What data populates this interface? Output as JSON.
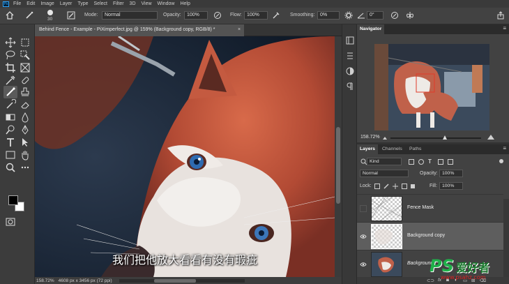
{
  "menubar": {
    "logo": "Ps",
    "items": [
      "File",
      "Edit",
      "Image",
      "Layer",
      "Type",
      "Select",
      "Filter",
      "3D",
      "View",
      "Window",
      "Help"
    ]
  },
  "options": {
    "brush_size": "30",
    "mode_label": "Mode:",
    "mode_value": "Normal",
    "opacity_label": "Opacity:",
    "opacity_value": "100%",
    "flow_label": "Flow:",
    "flow_value": "100%",
    "smoothing_label": "Smoothing:",
    "smoothing_value": "0%",
    "angle_value": "0°"
  },
  "document": {
    "tab_title": "Behind Fence - Example - PiXimperfect.jpg @ 159% (Background copy, RGB/8) *",
    "close_glyph": "×",
    "subtitle": "我们把他放大看看有没有瑕疵"
  },
  "status": {
    "zoom": "158.72%",
    "dimensions": "4608 px x 3456 px (72 ppi)"
  },
  "navigator": {
    "tab": "Navigator",
    "zoom": "158.72%"
  },
  "layers": {
    "tabs": [
      "Layers",
      "Channels",
      "Paths"
    ],
    "filter_label": "Kind",
    "blend_mode": "Normal",
    "opacity_label": "Opacity:",
    "opacity_value": "100%",
    "lock_label": "Lock:",
    "fill_label": "Fill:",
    "fill_value": "100%",
    "items": [
      {
        "name": "Fence Mask",
        "visible": false,
        "selected": false
      },
      {
        "name": "Background copy",
        "visible": true,
        "selected": true
      },
      {
        "name": "Background",
        "visible": true,
        "selected": false
      }
    ],
    "footer_icons": [
      "link-icon",
      "fx-icon",
      "mask-icon",
      "adjustment-icon",
      "folder-icon",
      "new-layer-icon",
      "trash-icon"
    ],
    "footer_fx": "fx"
  },
  "watermark": {
    "ps": "PS",
    "cn": "爱好者",
    "url": "www.psahz.com"
  },
  "colors": {
    "accent": "#31a8ff",
    "panel_bg": "#424242",
    "selected_layer": "#5e5e5e",
    "watermark_green": "#1fb04a",
    "watermark_red": "#e02222"
  }
}
